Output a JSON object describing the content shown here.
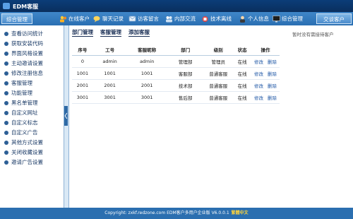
{
  "app": {
    "title": "EDM客服"
  },
  "menubar": {
    "left_tab": "综合管理",
    "items": [
      {
        "label": "在线客户",
        "icon": "users-icon"
      },
      {
        "label": "聊天记录",
        "icon": "chat-icon"
      },
      {
        "label": "访客留言",
        "icon": "message-icon"
      },
      {
        "label": "内部交流",
        "icon": "team-icon"
      },
      {
        "label": "技术离线",
        "icon": "tech-icon"
      },
      {
        "label": "个人信息",
        "icon": "person-icon"
      },
      {
        "label": "综合管理",
        "icon": "monitor-icon"
      }
    ],
    "right_tab": "交谈客户"
  },
  "sidebar": {
    "items": [
      "查看访问统计",
      "获取安装代码",
      "界面风格设置",
      "主动邀请设置",
      "修改注册信息",
      "客服管理",
      "功能管理",
      "黑名单管理",
      "自定义网址",
      "自定义标志",
      "自定义广告",
      "其他方式设置",
      "关闭收藏设置",
      "邀请广告设置"
    ]
  },
  "main": {
    "subtabs": [
      "部门管理",
      "客服管理",
      "添加客服"
    ],
    "table": {
      "headers": [
        "序号",
        "工号",
        "客服昵称",
        "部门",
        "级别",
        "状态",
        "操作"
      ],
      "rows": [
        [
          "0",
          "admin",
          "admin",
          "管理部",
          "管理员",
          "在线"
        ],
        [
          "1001",
          "1001",
          "1001",
          "客服部",
          "普通客服",
          "在线"
        ],
        [
          "2001",
          "2001",
          "2001",
          "技术部",
          "普通客服",
          "在线"
        ],
        [
          "3001",
          "3001",
          "3001",
          "售后部",
          "普通客服",
          "在线"
        ]
      ],
      "action_edit": "修改",
      "action_delete": "删除"
    }
  },
  "right_panel": {
    "message": "暂时没有需接待客户"
  },
  "footer": {
    "text": "Copyright: zxkf.redzone.com EDM客户多用户企业版 V6.0.0.1",
    "lang": "繁體中文"
  },
  "colors": {
    "brand": "#2b6fb0",
    "accent": "#ffd43b"
  }
}
